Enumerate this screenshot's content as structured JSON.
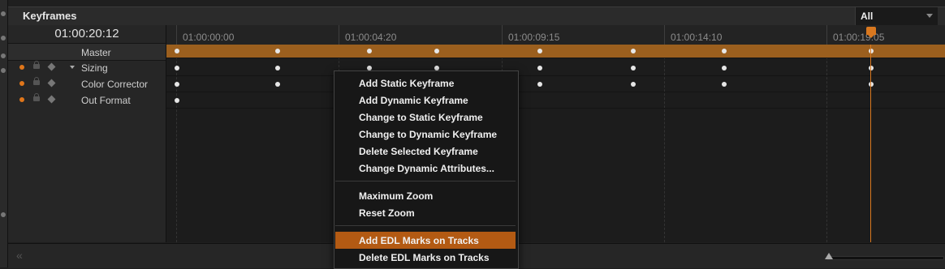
{
  "header": {
    "title": "Keyframes",
    "filter": {
      "value": "All"
    }
  },
  "left_panel": {
    "timecode": "01:00:20:12",
    "tracks": [
      {
        "name": "Master"
      },
      {
        "name": "Sizing"
      },
      {
        "name": "Color Corrector"
      },
      {
        "name": "Out Format"
      }
    ]
  },
  "ruler": {
    "labels": [
      "01:00:00:00",
      "01:00:04:20",
      "01:00:09:15",
      "01:00:14:10",
      "01:00:19:05"
    ]
  },
  "context_menu": {
    "items": [
      {
        "label": "Add Static Keyframe"
      },
      {
        "label": "Add Dynamic Keyframe"
      },
      {
        "label": "Change to Static Keyframe"
      },
      {
        "label": "Change to Dynamic Keyframe"
      },
      {
        "label": "Delete Selected Keyframe"
      },
      {
        "label": "Change Dynamic Attributes..."
      },
      {
        "label": "Maximum Zoom"
      },
      {
        "label": "Reset Zoom"
      },
      {
        "label": "Add EDL Marks on Tracks"
      },
      {
        "label": "Delete EDL Marks on Tracks"
      }
    ]
  },
  "colors": {
    "accent": "#d9781f",
    "master_bar": "#9b5f1e",
    "menu_highlight": "#b35a13"
  }
}
